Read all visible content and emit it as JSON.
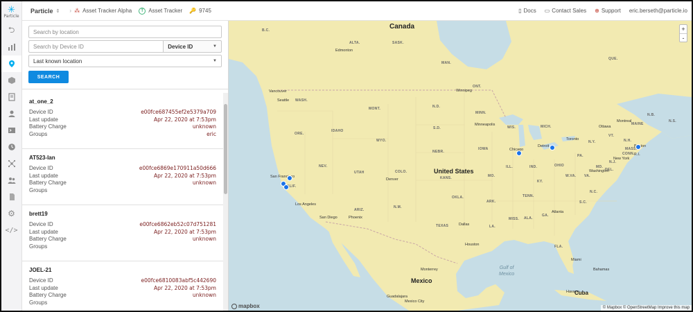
{
  "rail": {
    "logo_text": "Particle",
    "items": [
      {
        "icon": "back-arrow-icon"
      },
      {
        "icon": "bar-chart-icon"
      },
      {
        "icon": "map-pin-icon",
        "active": true
      },
      {
        "icon": "cube-icon"
      },
      {
        "icon": "document-icon"
      },
      {
        "icon": "user-icon"
      },
      {
        "icon": "terminal-icon"
      },
      {
        "icon": "clock-icon"
      },
      {
        "icon": "network-icon"
      },
      {
        "icon": "team-icon"
      },
      {
        "icon": "sim-card-icon"
      },
      {
        "icon": "gear-icon"
      },
      {
        "icon": "code-icon"
      }
    ]
  },
  "topbar": {
    "brand": "Particle",
    "product": "Asset Tracker Alpha",
    "fleet_icon_letter": "T",
    "fleet": "Asset Tracker",
    "product_id": "9745",
    "docs": "Docs",
    "contact": "Contact Sales",
    "support": "Support",
    "user": "eric.berseth@particle.io"
  },
  "search": {
    "location_placeholder": "Search by location",
    "device_placeholder": "Search by Device ID",
    "device_filter": "Device ID",
    "location_mode": "Last known location",
    "button": "SEARCH"
  },
  "labels": {
    "device_id": "Device ID",
    "last_update": "Last update",
    "battery": "Battery Charge",
    "groups": "Groups"
  },
  "devices": [
    {
      "name": "at_one_2",
      "device_id": "e00fce687455ef2e5379a709",
      "last_update": "Apr 22, 2020 at 7:53pm",
      "battery": "unknown",
      "groups": "eric"
    },
    {
      "name": "AT523-Ian",
      "device_id": "e00fce6869e170911a50d666",
      "last_update": "Apr 22, 2020 at 7:53pm",
      "battery": "unknown",
      "groups": ""
    },
    {
      "name": "brett19",
      "device_id": "e00fce6862eb52c07d751281",
      "last_update": "Apr 22, 2020 at 7:53pm",
      "battery": "unknown",
      "groups": ""
    },
    {
      "name": "JOEL-21",
      "device_id": "e00fce6810083abf5c442690",
      "last_update": "Apr 22, 2020 at 7:53pm",
      "battery": "unknown",
      "groups": ""
    }
  ],
  "map": {
    "countries": {
      "canada": "Canada",
      "us": "United States",
      "mexico": "Mexico",
      "cuba": "Cuba"
    },
    "water": {
      "gulf_line1": "Gulf of",
      "gulf_line2": "Mexico"
    },
    "states": [
      "WASH.",
      "ORE.",
      "IDAHO",
      "MONT.",
      "WYO.",
      "NEV.",
      "UTAH",
      "COLO.",
      "CALIF.",
      "ARIZ.",
      "N.M.",
      "N.D.",
      "S.D.",
      "NEBR.",
      "KANS.",
      "OKLA.",
      "TEXAS",
      "MINN.",
      "IOWA",
      "MO.",
      "ARK.",
      "LA.",
      "MISS.",
      "ALA.",
      "GA.",
      "FLA.",
      "TENN.",
      "KY.",
      "ILL.",
      "IND.",
      "OHIO",
      "MICH.",
      "WIS.",
      "PA.",
      "N.Y.",
      "VA.",
      "N.C.",
      "S.C.",
      "MAINE",
      "VT.",
      "N.H.",
      "MASS.",
      "CONN.",
      "N.J.",
      "DEL.",
      "MD.",
      "W.VA.",
      "R.I."
    ],
    "provinces": [
      "B.C.",
      "ALTA.",
      "SASK.",
      "MAN.",
      "ONT.",
      "QUE.",
      "N.B.",
      "N.S."
    ],
    "cities": [
      "Edmonton",
      "Vancouver",
      "Seattle",
      "Winnipeg",
      "Minneapolis",
      "Chicago",
      "Detroit",
      "Toronto",
      "Ottawa",
      "Montreal",
      "Boston",
      "New York",
      "Washington",
      "Denver",
      "Dallas",
      "Houston",
      "Phoenix",
      "San Diego",
      "Los Angeles",
      "San Francisco",
      "Atlanta",
      "Miami",
      "Monterrey",
      "Guadalajara",
      "Havana",
      "Bahamas",
      "Mexico City"
    ],
    "pins": [
      {
        "name": "california-1"
      },
      {
        "name": "california-2"
      },
      {
        "name": "california-3"
      },
      {
        "name": "chicago"
      },
      {
        "name": "michigan"
      },
      {
        "name": "boston"
      }
    ],
    "zoom_in": "+",
    "zoom_out": "-",
    "logo": "mapbox",
    "attribution": "© Mapbox © OpenStreetMap  Improve this map"
  },
  "colors": {
    "accent": "#00aeef",
    "button": "#0f8ae0",
    "pin": "#1b73e8",
    "land": "#f2eab1",
    "water": "#c6dde6",
    "value_text": "#7a1d1d"
  }
}
